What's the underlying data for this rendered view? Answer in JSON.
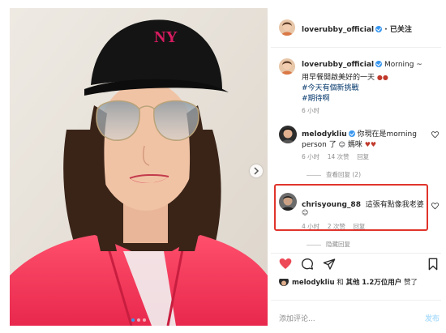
{
  "post": {
    "author": "loverubby_official",
    "follow_status": "· 已关注"
  },
  "caption": {
    "author": "loverubby_official",
    "line1_suffix": "Morning ~",
    "line2": "用早餐開啟美好的一天",
    "line3": "#今天有個新挑戰",
    "line4": "#期待啊",
    "time": "6 小时"
  },
  "comments": [
    {
      "author": "melodykliu",
      "text1": "你現在是morning",
      "text2": "person 了",
      "text2_suffix": "媽咪",
      "time": "6 小时",
      "likes": "14 次赞",
      "reply_label": "回复",
      "replies_toggle": "查看回复 (2)"
    },
    {
      "author": "chrisyoung_88",
      "text1": "這張有點像我老婆",
      "time": "4 小时",
      "likes": "2 次赞",
      "reply_label": "回复",
      "replies_toggle": "隐藏回复"
    }
  ],
  "likes_summary": {
    "user": "melodykliu",
    "conj": "和",
    "others_label": "其他",
    "count": "1.2万",
    "unit": "位用户",
    "verb": "赞了"
  },
  "comment_box": {
    "placeholder": "添加评论...",
    "post_label": "发布"
  },
  "colors": {
    "accent": "#3897f0",
    "heart": "#ed4956",
    "highlight_box": "#e0342c"
  },
  "icons": [
    "heart-icon",
    "comment-icon",
    "share-icon",
    "bookmark-icon",
    "verified-icon",
    "chevron-right-icon"
  ]
}
